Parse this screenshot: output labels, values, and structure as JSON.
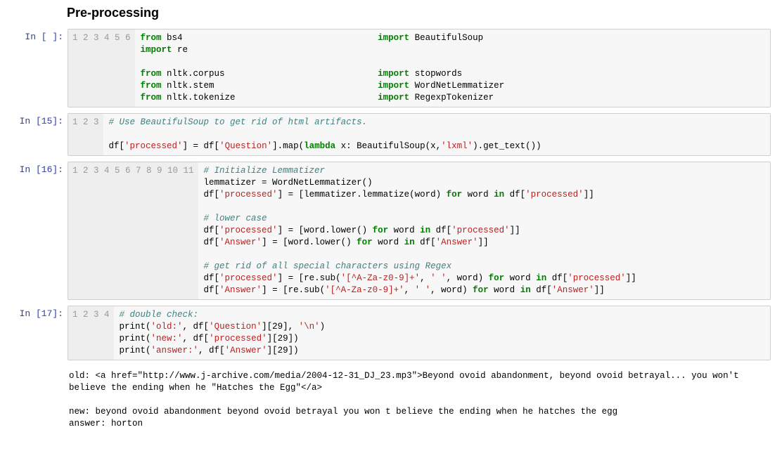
{
  "heading": "Pre-processing",
  "cells": [
    {
      "prompt": "In [ ]:",
      "gutter": "1\n2\n3\n4\n5\n6",
      "code": "<span class=\"kw\">from</span> bs4                                     <span class=\"kw\">import</span> BeautifulSoup\n<span class=\"kw\">import</span> re\n\n<span class=\"kw\">from</span> nltk.corpus                             <span class=\"kw\">import</span> stopwords\n<span class=\"kw\">from</span> nltk.stem                               <span class=\"kw\">import</span> WordNetLemmatizer\n<span class=\"kw\">from</span> nltk.tokenize                           <span class=\"kw\">import</span> RegexpTokenizer"
    },
    {
      "prompt": "In [15]:",
      "gutter": "1\n2\n3",
      "code": "<span class=\"cm\"># Use BeautifulSoup to get rid of html artifacts.</span>\n\ndf[<span class=\"str\">'processed'</span>] = df[<span class=\"str\">'Question'</span>].map(<span class=\"kw\">lambda</span> x: BeautifulSoup(x,<span class=\"str\">'lxml'</span>).get_text())"
    },
    {
      "prompt": "In [16]:",
      "gutter": "1\n2\n3\n4\n5\n6\n7\n8\n9\n10\n11",
      "code": "<span class=\"cm\"># Initialize Lemmatizer</span>\nlemmatizer = WordNetLemmatizer()\ndf[<span class=\"str\">'processed'</span>] = [lemmatizer.lemmatize(word) <span class=\"kw\">for</span> word <span class=\"kw\">in</span> df[<span class=\"str\">'processed'</span>]]\n\n<span class=\"cm\"># lower case</span>\ndf[<span class=\"str\">'processed'</span>] = [word.lower() <span class=\"kw\">for</span> word <span class=\"kw\">in</span> df[<span class=\"str\">'processed'</span>]]\ndf[<span class=\"str\">'Answer'</span>] = [word.lower() <span class=\"kw\">for</span> word <span class=\"kw\">in</span> df[<span class=\"str\">'Answer'</span>]]\n\n<span class=\"cm\"># get rid of all special characters using Regex</span>\ndf[<span class=\"str\">'processed'</span>] = [re.sub(<span class=\"str\">'[^A-Za-z0-9]+'</span>, <span class=\"str\">' '</span>, word) <span class=\"kw\">for</span> word <span class=\"kw\">in</span> df[<span class=\"str\">'processed'</span>]]\ndf[<span class=\"str\">'Answer'</span>] = [re.sub(<span class=\"str\">'[^A-Za-z0-9]+'</span>, <span class=\"str\">' '</span>, word) <span class=\"kw\">for</span> word <span class=\"kw\">in</span> df[<span class=\"str\">'Answer'</span>]]"
    },
    {
      "prompt": "In [17]:",
      "gutter": "1\n2\n3\n4",
      "code": "<span class=\"cm\"># double check:</span>\nprint(<span class=\"str\">'old:'</span>, df[<span class=\"str\">'Question'</span>][29], <span class=\"str\">'\\n'</span>)\nprint(<span class=\"str\">'new:'</span>, df[<span class=\"str\">'processed'</span>][29])\nprint(<span class=\"str\">'answer:'</span>, df[<span class=\"str\">'Answer'</span>][29])",
      "output": "old: <a href=\"http://www.j-archive.com/media/2004-12-31_DJ_23.mp3\">Beyond ovoid abandonment, beyond ovoid betrayal... you won't believe the ending when he \"Hatches the Egg\"</a> \n\nnew: beyond ovoid abandonment beyond ovoid betrayal you won t believe the ending when he hatches the egg \nanswer: horton"
    }
  ]
}
